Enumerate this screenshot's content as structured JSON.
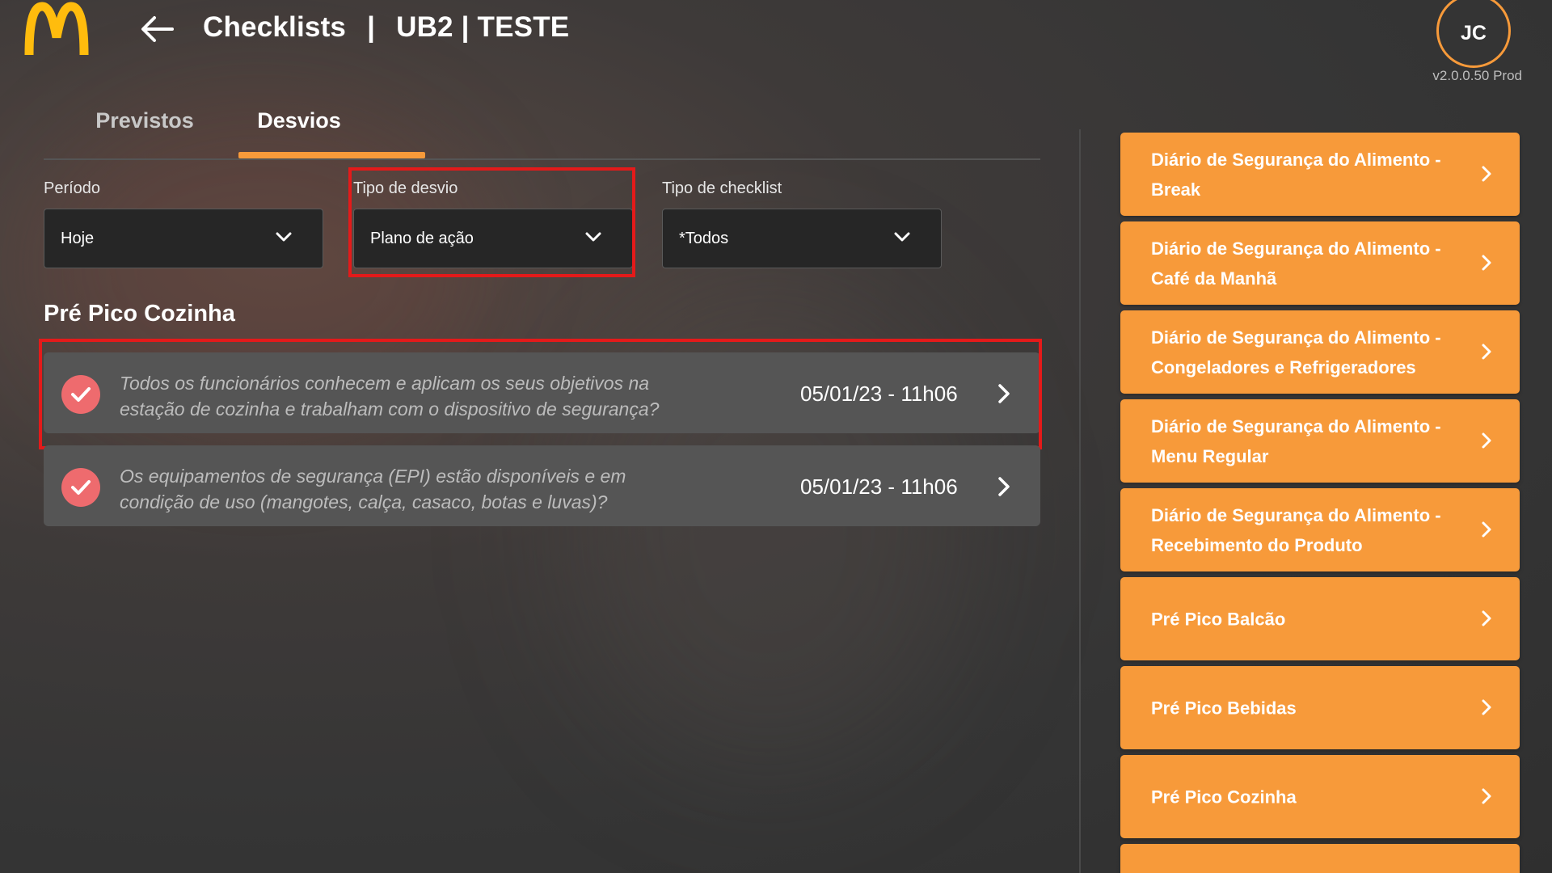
{
  "header": {
    "title": "Checklists",
    "separator": "|",
    "store": "UB2 | TESTE",
    "user_initials": "JC",
    "version": "v2.0.0.50 Prod"
  },
  "tabs": [
    {
      "label": "Previstos",
      "active": false
    },
    {
      "label": "Desvios",
      "active": true
    }
  ],
  "filters": {
    "periodo": {
      "label": "Período",
      "value": "Hoje"
    },
    "tipo_desvio": {
      "label": "Tipo de desvio",
      "value": "Plano de ação"
    },
    "tipo_checklist": {
      "label": "Tipo de checklist",
      "value": "*Todos"
    }
  },
  "section": {
    "title": "Pré Pico Cozinha",
    "items": [
      {
        "text": "Todos os funcionários conhecem e aplicam os seus objetivos na estação de cozinha e trabalham com o dispositivo de segurança?",
        "date": "05/01/23 - 11h06"
      },
      {
        "text": "Os equipamentos de segurança (EPI) estão disponíveis e em condição de uso (mangotes, calça, casaco, botas e luvas)?",
        "date": "05/01/23 - 11h06"
      }
    ]
  },
  "checklists": [
    {
      "label": "Diário de Segurança do Alimento - Break"
    },
    {
      "label": "Diário de Segurança do Alimento - Café da Manhã"
    },
    {
      "label": "Diário de Segurança do Alimento - Congeladores e Refrigeradores"
    },
    {
      "label": "Diário de Segurança do Alimento - Menu Regular"
    },
    {
      "label": "Diário de Segurança do Alimento - Recebimento do Produto"
    },
    {
      "label": "Pré Pico Balcão"
    },
    {
      "label": "Pré Pico Bebidas"
    },
    {
      "label": "Pré Pico Cozinha"
    },
    {
      "label": ""
    }
  ],
  "colors": {
    "accent": "#f79a3a",
    "highlight": "#e41a1a",
    "check": "#ee6b6e",
    "logo": "#ffbc0d"
  },
  "icons": [
    "mcdonalds-logo",
    "back-arrow-icon",
    "chevron-down-icon",
    "check-icon",
    "chevron-right-icon"
  ]
}
